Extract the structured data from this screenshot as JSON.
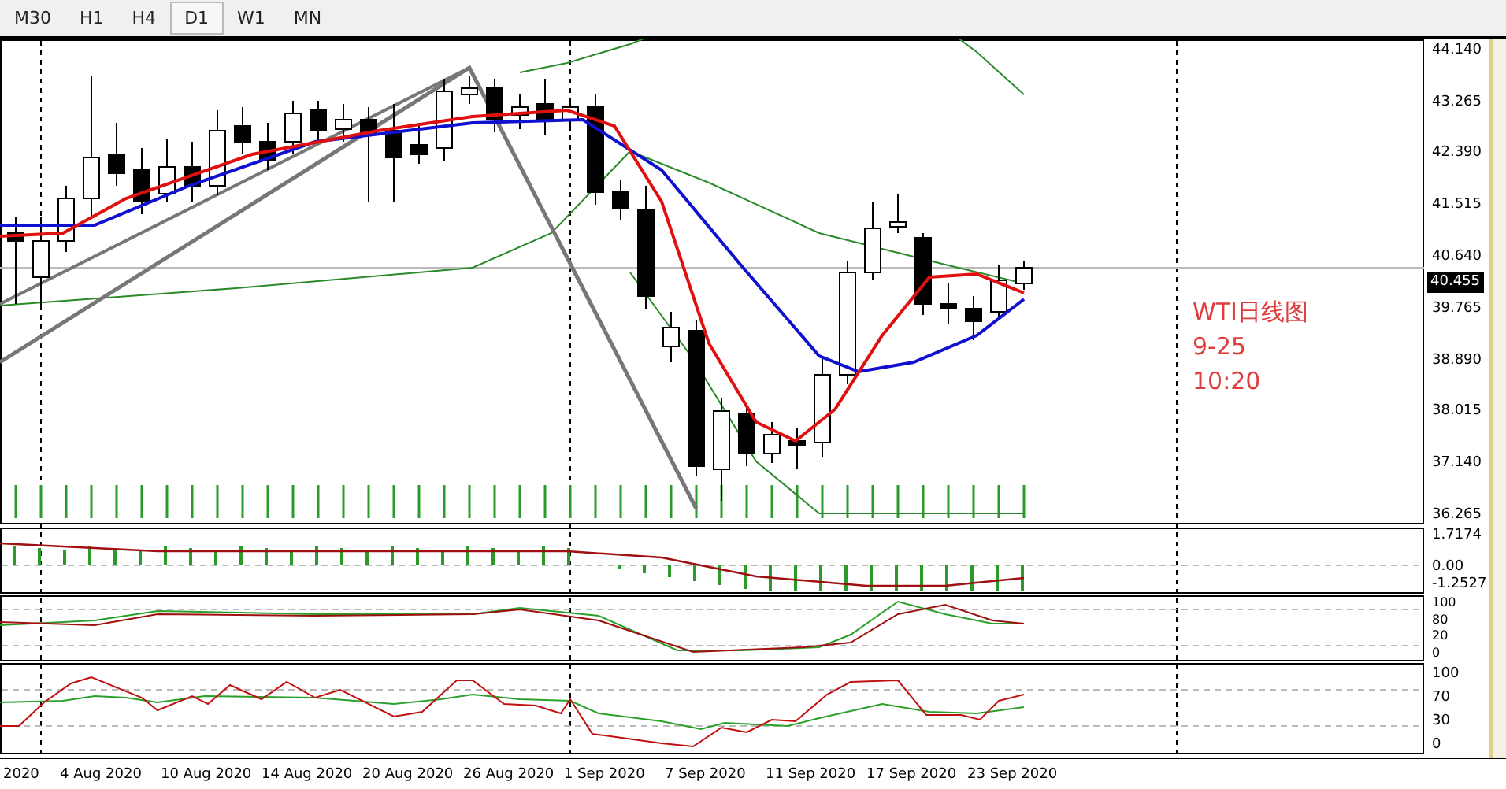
{
  "timeframes": [
    {
      "label": "M30",
      "selected": false
    },
    {
      "label": "H1",
      "selected": false
    },
    {
      "label": "H4",
      "selected": false
    },
    {
      "label": "D1",
      "selected": true
    },
    {
      "label": "W1",
      "selected": false
    },
    {
      "label": "MN",
      "selected": false
    }
  ],
  "price_axis": {
    "labels": [
      "44.140",
      "43.265",
      "42.390",
      "41.515",
      "40.640",
      "39.765",
      "38.890",
      "38.015",
      "37.140",
      "36.265"
    ],
    "current_price": "40.455"
  },
  "macd_axis": [
    "1.7174",
    "0.00",
    "-1.2527"
  ],
  "stochastic_axis": [
    "100",
    "80",
    "20",
    "0"
  ],
  "rsi_axis": [
    "100",
    "70",
    "30",
    "0"
  ],
  "date_axis": [
    "2020",
    "4 Aug 2020",
    "10 Aug 2020",
    "14 Aug 2020",
    "20 Aug 2020",
    "26 Aug 2020",
    "1 Sep 2020",
    "7 Sep 2020",
    "11 Sep 2020",
    "17 Sep 2020",
    "23 Sep 2020"
  ],
  "annotation": [
    "WTI日线图",
    "9-25",
    "10:20"
  ]
}
